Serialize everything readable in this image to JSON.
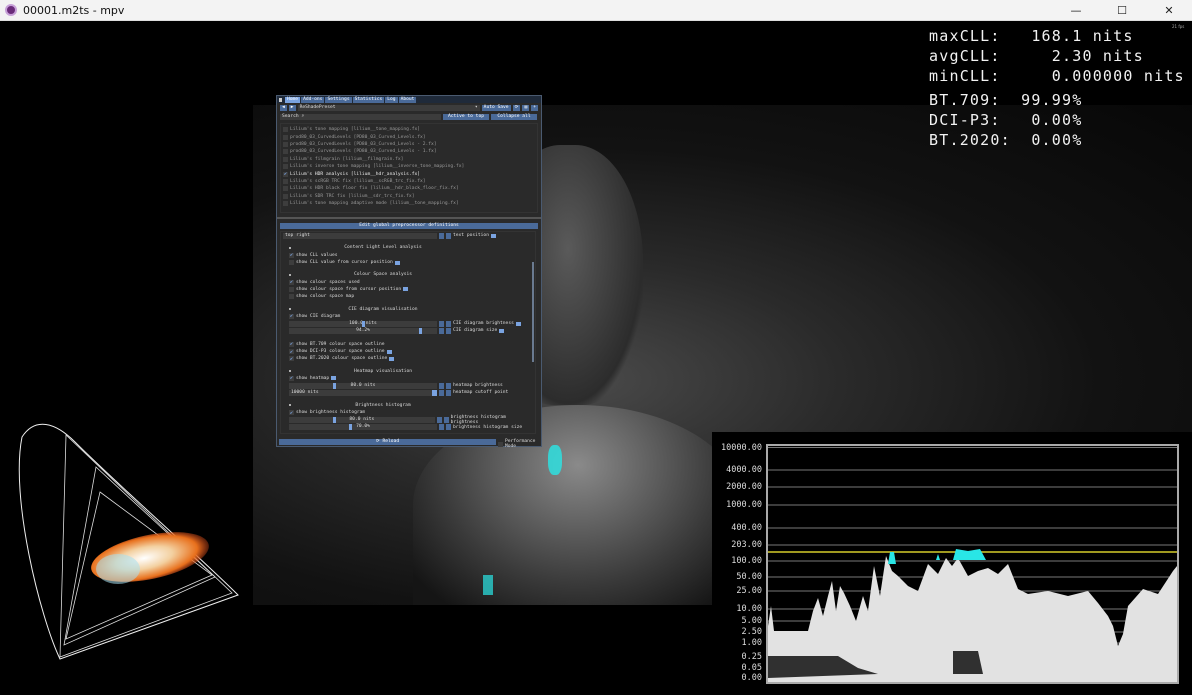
{
  "window": {
    "title": "00001.m2ts - mpv",
    "minimize": "—",
    "maximize": "☐",
    "close": "✕"
  },
  "fps": "21 fps",
  "stats": {
    "cll": [
      {
        "label": "maxCLL:",
        "value": "   168.1 nits"
      },
      {
        "label": "avgCLL:",
        "value": "     2.30 nits"
      },
      {
        "label": "minCLL:",
        "value": "     0.000000 nits"
      }
    ],
    "gamut": [
      {
        "label": "BT.709:",
        "value": "  99.99%"
      },
      {
        "label": "DCI-P3:",
        "value": "   0.00%"
      },
      {
        "label": "BT.2020:",
        "value": "  0.00%"
      }
    ]
  },
  "panel": {
    "tabs": [
      "Home",
      "Add-ons",
      "Settings",
      "Statistics",
      "Log",
      "About"
    ],
    "preset": "ReShadePreset",
    "auto_save": "Auto Save",
    "search_placeholder": "Search",
    "active_to_top": "Active to top",
    "collapse_all": "Collapse all",
    "effects": [
      {
        "label": "Lilium's tone mapping [lilium__tone_mapping.fx]",
        "on": false
      },
      {
        "label": "prod80_03_CurvedLevels [PD80_03_Curved_Levels.fx]",
        "on": false
      },
      {
        "label": "prod80_03_CurvedLevels [PD80_03_Curved_Levels - 2.fx]",
        "on": false
      },
      {
        "label": "prod80_03_CurvedLevels [PD80_03_Curved_Levels - 1.fx]",
        "on": false
      },
      {
        "label": "Lilium's filmgrain [lilium__filmgrain.fx]",
        "on": false
      },
      {
        "label": "Lilium's inverse tone mapping [lilium__inverse_tone_mapping.fx]",
        "on": false
      },
      {
        "label": "Lilium's HDR analysis [lilium__hdr_analysis.fx]",
        "on": true
      },
      {
        "label": "Lilium's scRGB TRC fix [lilium__scRGB_trc_fix.fx]",
        "on": false
      },
      {
        "label": "Lilium's HDR black floor fix [lilium__hdr_black_floor_fix.fx]",
        "on": false
      },
      {
        "label": "Lilium's SDR TRC fix [lilium__sdr_trc_fix.fx]",
        "on": false
      },
      {
        "label": "Lilium's tone mapping adaptive mode [lilium__tone_mapping.fx]",
        "on": false
      }
    ],
    "edit_defs": "Edit global preprocessor definitions",
    "text_position_value": "top right",
    "text_position_label": "text position",
    "sections": {
      "cll": {
        "title": "Content Light Level analysis",
        "show_values": "show CLL values",
        "show_cursor": "show CLL value from cursor position"
      },
      "cs": {
        "title": "Colour Space analysis",
        "show_used": "show colour spaces used",
        "show_cursor": "show colour space from cursor position",
        "show_map": "show colour space map"
      },
      "cie": {
        "title": "CIE diagram visualisation",
        "show": "show CIE diagram",
        "brightness_value": "100.0 nits",
        "brightness_label": "CIE diagram brightness",
        "size_value": "94.2%",
        "size_label": "CIE diagram size",
        "bt709": "show BT.709 colour space outline",
        "p3": "show DCI-P3 colour space outline",
        "bt2020": "show BT.2020 colour space outline"
      },
      "heat": {
        "title": "Heatmap visualisation",
        "show": "show heatmap",
        "brightness_value": "80.0 nits",
        "brightness_label": "heatmap brightness",
        "cutoff_value": "10000 nits",
        "cutoff_label": "heatmap cutoff point"
      },
      "hist": {
        "title": "Brightness histogram",
        "show": "show brightness histogram",
        "brightness_value": "80.0 nits",
        "brightness_label": "brightness histogram brightness",
        "size_value": "70.0%",
        "size_label": "brightness histogram size"
      }
    },
    "reload": "⟳ Reload",
    "performance_mode": "Performance Mode"
  },
  "histogram": {
    "y_labels": [
      "10000.00",
      "4000.00",
      "2000.00",
      "1000.00",
      "400.00",
      "203.00",
      "100.00",
      "50.00",
      "25.00",
      "10.00",
      "5.00",
      "2.50",
      "1.00",
      "0.25",
      "0.05",
      "0.00"
    ],
    "reference_line_color": "#a09a20",
    "clip_color": "#29e6e6"
  }
}
